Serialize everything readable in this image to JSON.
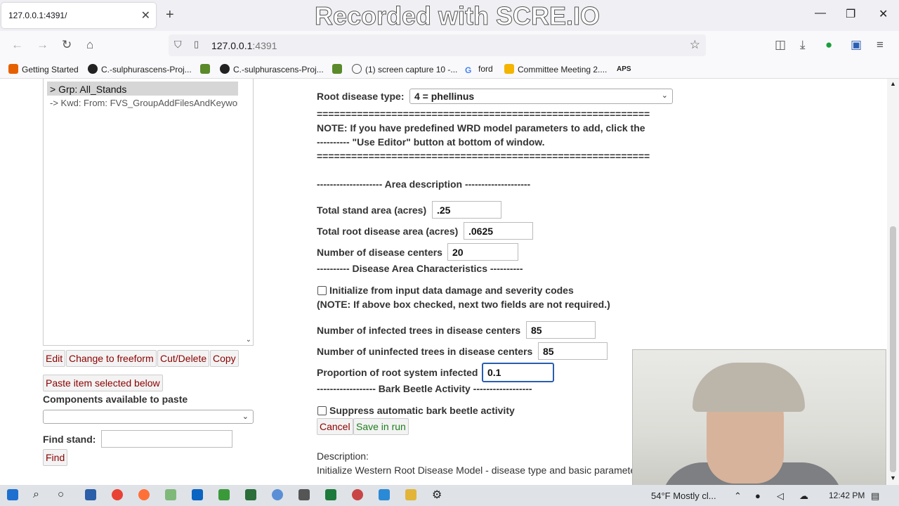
{
  "browser": {
    "tab_title": "127.0.0.1:4391/",
    "watermark": "Recorded with SCRE.IO",
    "url_host": "127.0.0.1",
    "url_port": ":4391"
  },
  "bookmarks": [
    {
      "label": "Getting Started",
      "color": "#e66000"
    },
    {
      "label": "C.-sulphurascens-Proj...",
      "color": "#222222"
    },
    {
      "label": "C.-sulphurascens-Proj...",
      "color": "#222222"
    },
    {
      "label": "(1) screen capture 10 -...",
      "color": "#555555"
    },
    {
      "label": "ford",
      "color": "#4285f4"
    },
    {
      "label": "Committee Meeting 2....",
      "color": "#f4b400"
    },
    {
      "label": "APS",
      "color": "#2e7d32"
    }
  ],
  "tree": {
    "selected_item": "> Grp: All_Stands",
    "keyword_item": "-> Kwd: From: FVS_GroupAddFilesAndKeywords"
  },
  "left_buttons": {
    "edit": "Edit",
    "change_freeform": "Change to freeform",
    "cut_delete": "Cut/Delete",
    "copy": "Copy",
    "paste_selected": "Paste item selected below",
    "components_label": "Components available to paste",
    "find_stand_label": "Find stand:",
    "find": "Find"
  },
  "form": {
    "root_disease_label": "Root disease type:",
    "root_disease_value": "4 = phellinus",
    "separator": "==========================================================",
    "note_line1": "NOTE: If you have predefined WRD model parameters to add, click the",
    "note_line2": "---------- \"Use Editor\" button at bottom of window.",
    "area_header": "-------------------- Area description --------------------",
    "total_stand_label": "Total stand area (acres)",
    "total_stand_value": ".25",
    "root_area_label": "Total root disease area (acres)",
    "root_area_value": ".0625",
    "centers_label": "Number of disease centers",
    "centers_value": "20",
    "characteristics_header": "---------- Disease Area Characteristics ----------",
    "init_checkbox_label": "Initialize from input data damage and severity codes",
    "init_note": "(NOTE: If above box checked, next two fields are not required.)",
    "infected_label": "Number of infected trees in disease centers",
    "infected_value": "85",
    "uninfected_label": "Number of uninfected trees in disease centers",
    "uninfected_value": "85",
    "proportion_label": "Proportion of root system infected",
    "proportion_value": "0.1",
    "beetle_header": "------------------ Bark Beetle Activity ------------------",
    "suppress_label": "Suppress automatic bark beetle activity",
    "cancel": "Cancel",
    "save": "Save in run",
    "description_label": "Description:",
    "description_text": "Initialize Western Root Disease Model - disease type and basic parameters"
  },
  "taskbar": {
    "weather": "54°F  Mostly cl...",
    "time": "12:42 PM"
  },
  "colors": {
    "button_text": "#8b0000",
    "save_text": "#1e7d1e",
    "focus_border": "#2a5db0"
  }
}
